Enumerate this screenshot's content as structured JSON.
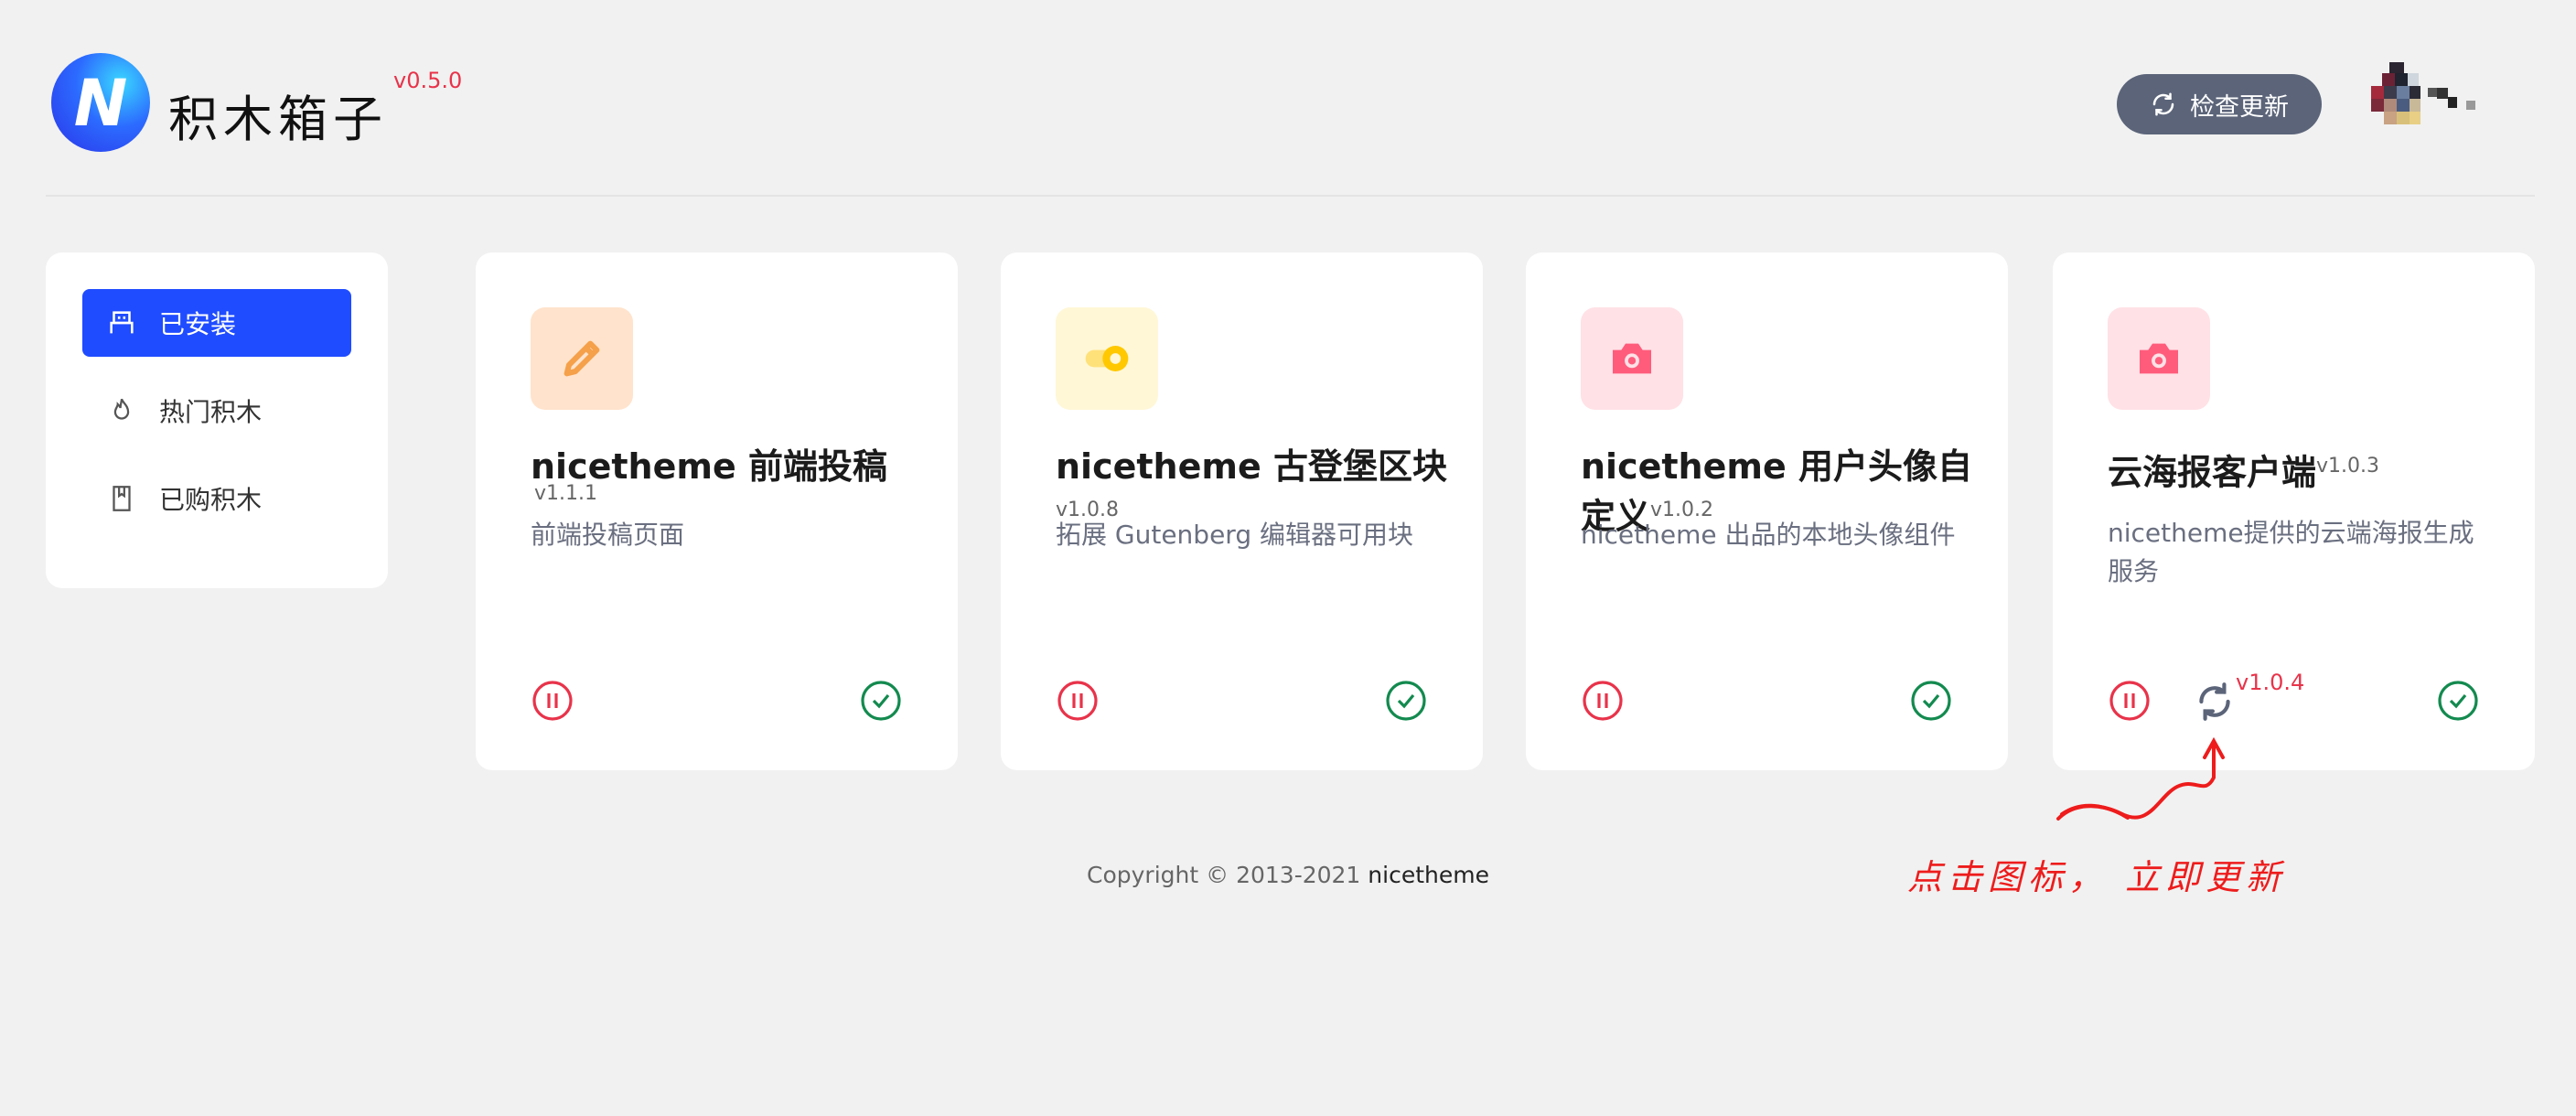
{
  "app": {
    "title": "积木箱子",
    "version": "v0.5.0",
    "logo_letter": "N",
    "update_button": "检查更新"
  },
  "sidebar": {
    "items": [
      {
        "label": "已安装",
        "icon": "installed-icon",
        "active": true
      },
      {
        "label": "热门积木",
        "icon": "flame-icon",
        "active": false
      },
      {
        "label": "已购积木",
        "icon": "bookmark-icon",
        "active": false
      }
    ]
  },
  "cards": [
    {
      "name": "nicetheme 前端投稿",
      "version": "v1.1.1",
      "desc": "前端投稿页面",
      "icon": "pencil-icon",
      "icon_color": "#f5a04a",
      "icon_bg": "#ffe3cc"
    },
    {
      "name": "nicetheme 古登堡区块",
      "version": "v1.0.8",
      "desc": "拓展 Gutenberg 编辑器可用块",
      "icon": "toggle-icon",
      "icon_color": "#ffc800",
      "icon_bg": "#fff7d6"
    },
    {
      "name": "nicetheme 用户头像自定义",
      "version": "v1.0.2",
      "desc": "nicetheme 出品的本地头像组件",
      "icon": "camera-icon",
      "icon_color": "#ff5c7c",
      "icon_bg": "#ffe1e6"
    },
    {
      "name": "云海报客户端",
      "version": "v1.0.3",
      "desc": "nicetheme提供的云端海报生成服务",
      "icon": "camera-icon",
      "icon_color": "#ff5c7c",
      "icon_bg": "#ffe1e6",
      "update_version": "v1.0.4"
    }
  ],
  "footer": {
    "copyright": "Copyright © 2013-2021",
    "brand": "nicetheme"
  },
  "annotation": {
    "text": "点击图标， 立即更新"
  },
  "colors": {
    "accent": "#1f4cff",
    "danger": "#e8334a",
    "success": "#138a4f",
    "button_gray": "#5b6479"
  }
}
